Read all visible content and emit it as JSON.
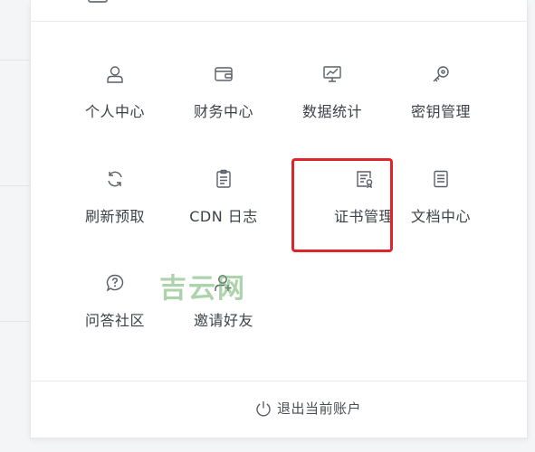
{
  "menu": {
    "items": [
      {
        "label": "个人中心",
        "icon": "user-icon"
      },
      {
        "label": "财务中心",
        "icon": "wallet-icon"
      },
      {
        "label": "数据统计",
        "icon": "chart-presentation-icon"
      },
      {
        "label": "密钥管理",
        "icon": "key-icon"
      },
      {
        "label": "刷新预取",
        "icon": "refresh-icon"
      },
      {
        "label": "CDN 日志",
        "icon": "clipboard-icon"
      },
      {
        "label": "证书管理",
        "icon": "certificate-icon"
      },
      {
        "label": "文档中心",
        "icon": "document-icon"
      },
      {
        "label": "问答社区",
        "icon": "question-bubble-icon"
      },
      {
        "label": "邀请好友",
        "icon": "invite-user-icon"
      }
    ],
    "highlighted": "证书管理",
    "highlight_color": "#e0242b"
  },
  "watermark": "吉云网",
  "logout": {
    "label": "退出当前账户",
    "icon": "power-icon"
  }
}
